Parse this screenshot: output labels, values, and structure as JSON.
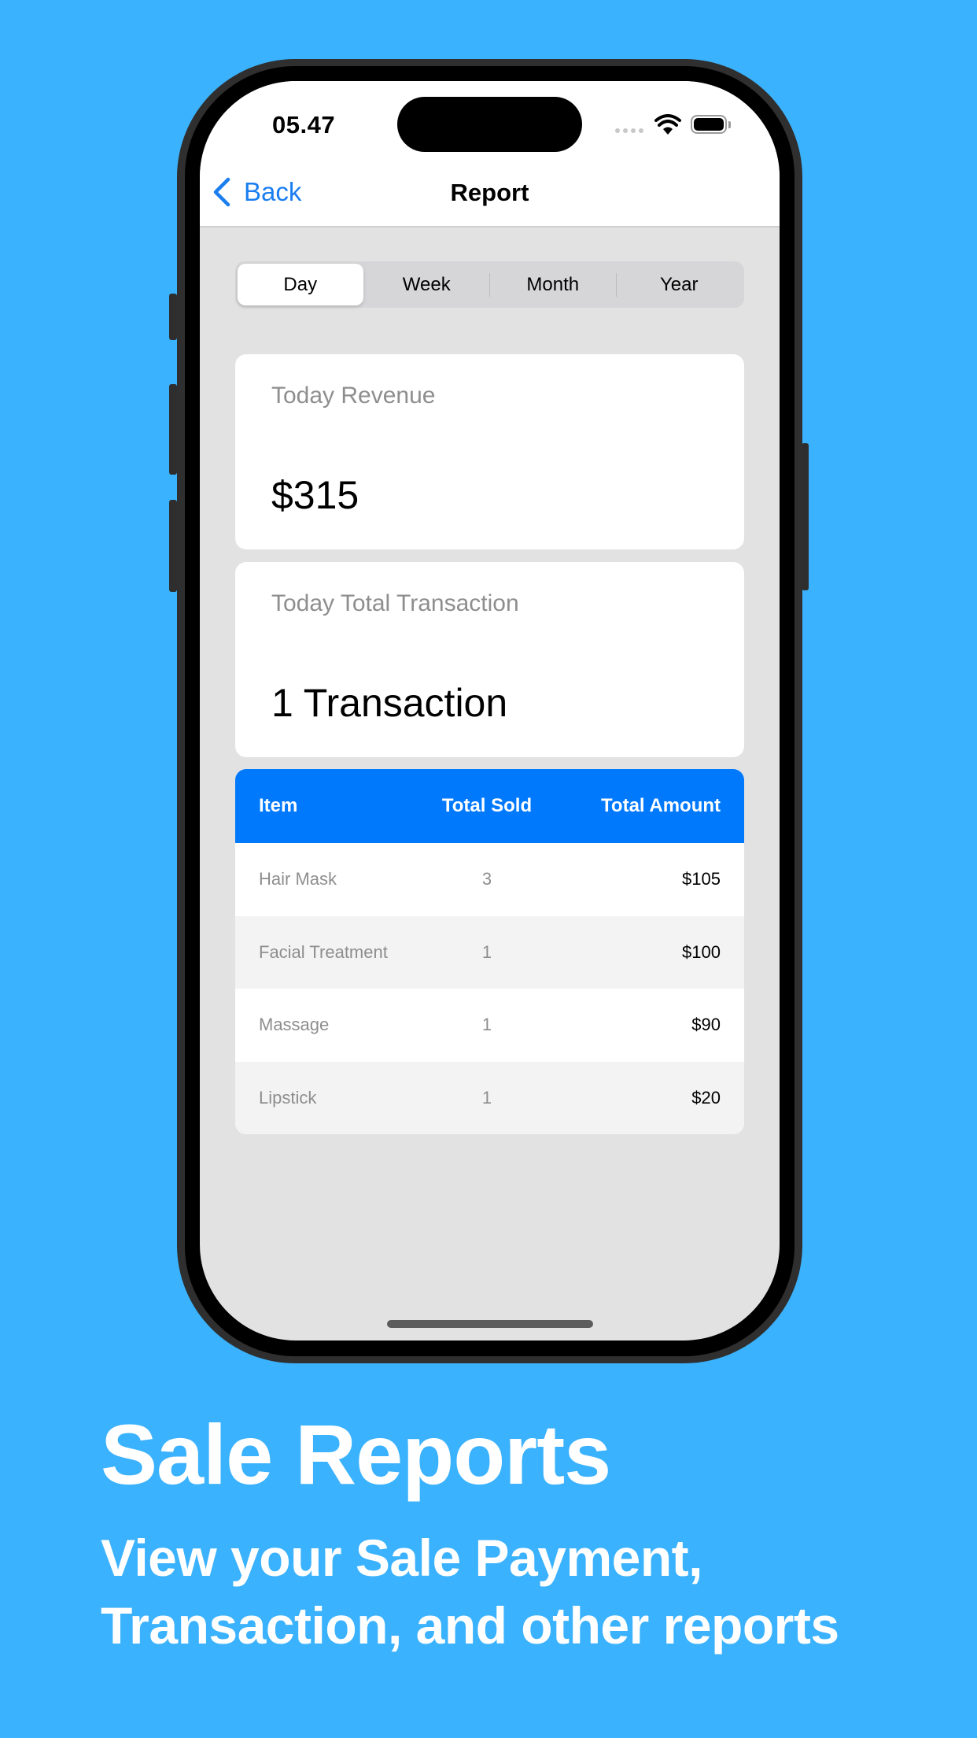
{
  "status_bar": {
    "time": "05.47",
    "icons": [
      "signal-icon",
      "wifi-icon",
      "battery-icon"
    ]
  },
  "nav": {
    "back_label": "Back",
    "title": "Report"
  },
  "segmented": {
    "options": [
      "Day",
      "Week",
      "Month",
      "Year"
    ],
    "selected": "Day"
  },
  "cards": [
    {
      "label": "Today Revenue",
      "value": "$315"
    },
    {
      "label": "Today Total Transaction",
      "value": "1 Transaction"
    }
  ],
  "table": {
    "headers": [
      "Item",
      "Total Sold",
      "Total Amount"
    ],
    "rows": [
      {
        "item": "Hair Mask",
        "sold": "3",
        "amount": "$105"
      },
      {
        "item": "Facial Treatment",
        "sold": "1",
        "amount": "$100"
      },
      {
        "item": "Massage",
        "sold": "1",
        "amount": "$90"
      },
      {
        "item": "Lipstick",
        "sold": "1",
        "amount": "$20"
      }
    ]
  },
  "promo": {
    "headline": "Sale Reports",
    "subline_1": "View your Sale Payment,",
    "subline_2": "Transaction, and other reports"
  },
  "colors": {
    "background": "#3bb2fd",
    "accent": "#0079fd",
    "link": "#1a7ef0"
  }
}
